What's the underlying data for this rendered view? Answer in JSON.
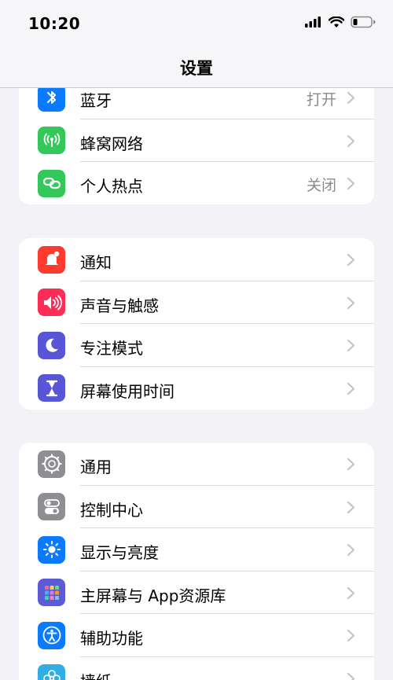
{
  "status": {
    "time": "10:20"
  },
  "nav": {
    "title": "设置"
  },
  "group1": {
    "items": [
      {
        "label": "蓝牙",
        "value": "打开",
        "color": "#0a7aff"
      },
      {
        "label": "蜂窝网络",
        "value": "",
        "color": "#34c759"
      },
      {
        "label": "个人热点",
        "value": "关闭",
        "color": "#34c759"
      }
    ]
  },
  "group2": {
    "items": [
      {
        "label": "通知",
        "value": "",
        "color": "#ff3b30"
      },
      {
        "label": "声音与触感",
        "value": "",
        "color": "#ff2d55"
      },
      {
        "label": "专注模式",
        "value": "",
        "color": "#5856d6"
      },
      {
        "label": "屏幕使用时间",
        "value": "",
        "color": "#5856d6"
      }
    ]
  },
  "group3": {
    "items": [
      {
        "label": "通用",
        "value": "",
        "color": "#8e8e93"
      },
      {
        "label": "控制中心",
        "value": "",
        "color": "#8e8e93"
      },
      {
        "label": "显示与亮度",
        "value": "",
        "color": "#0a7aff"
      },
      {
        "label": "主屏幕与 App资源库",
        "value": "",
        "color": "#5b5bd6"
      },
      {
        "label": "辅助功能",
        "value": "",
        "color": "#0a7aff"
      },
      {
        "label": "墙纸",
        "value": "",
        "color": "#32ade6"
      }
    ]
  }
}
